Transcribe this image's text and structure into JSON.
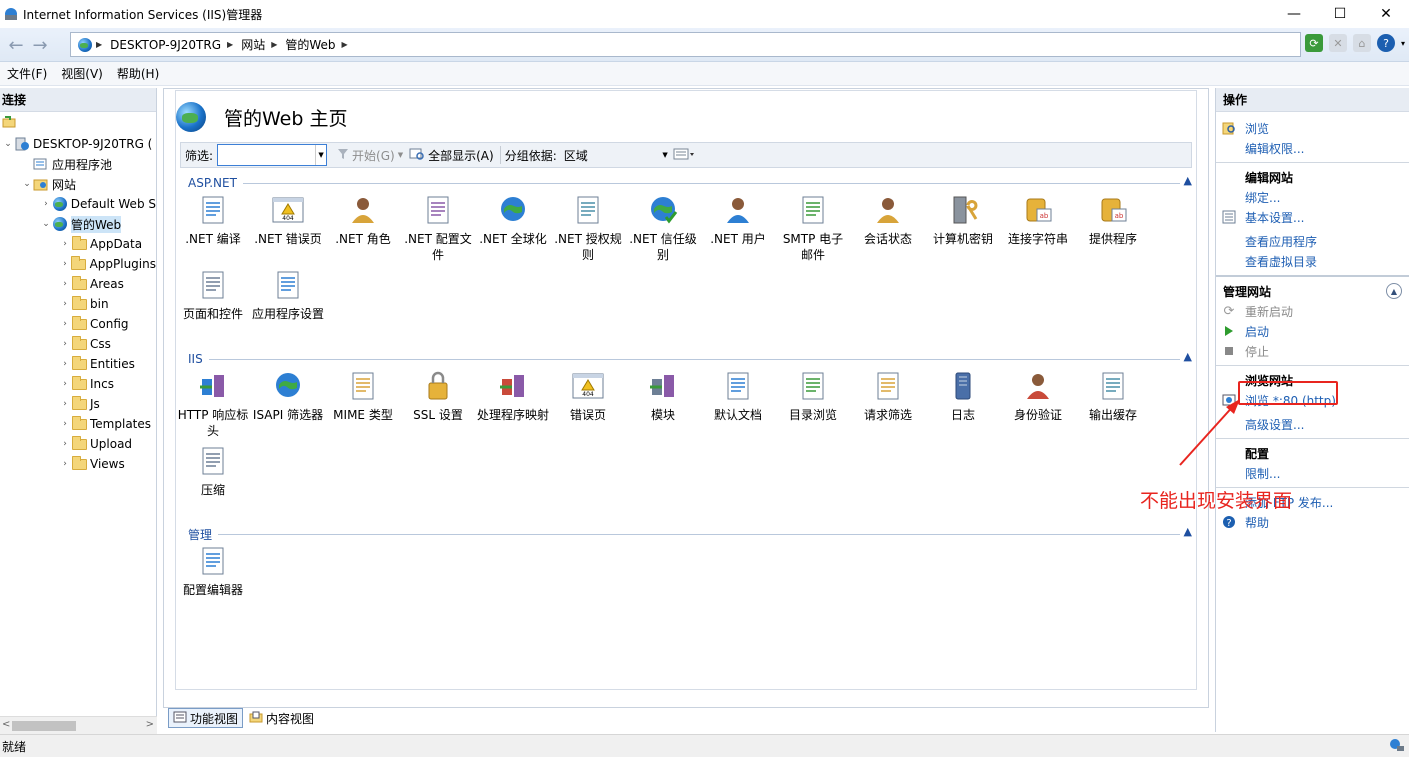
{
  "window": {
    "title": "Internet Information Services (IIS)管理器",
    "minimize": "—",
    "maximize": "☐",
    "close": "✕"
  },
  "address": {
    "crumbs": [
      "DESKTOP-9J20TRG",
      "网站",
      "管的Web"
    ]
  },
  "menu": [
    "文件(F)",
    "视图(V)",
    "帮助(H)"
  ],
  "connections": {
    "title": "连接",
    "tree": [
      {
        "label": "DESKTOP-9J20TRG (",
        "level": 0,
        "twisty": "⌄",
        "icon": "server-icon"
      },
      {
        "label": "应用程序池",
        "level": 1,
        "twisty": "",
        "icon": "app-pool-icon"
      },
      {
        "label": "网站",
        "level": 1,
        "twisty": "⌄",
        "icon": "sites-folder-icon"
      },
      {
        "label": "Default Web S",
        "level": 2,
        "twisty": "›",
        "icon": "globe-icon"
      },
      {
        "label": "管的Web",
        "level": 2,
        "twisty": "⌄",
        "icon": "globe-icon",
        "selected": true
      },
      {
        "label": "AppData",
        "level": 3,
        "twisty": "›",
        "icon": "folder-icon"
      },
      {
        "label": "AppPlugins",
        "level": 3,
        "twisty": "›",
        "icon": "folder-icon"
      },
      {
        "label": "Areas",
        "level": 3,
        "twisty": "›",
        "icon": "folder-icon"
      },
      {
        "label": "bin",
        "level": 3,
        "twisty": "›",
        "icon": "folder-icon"
      },
      {
        "label": "Config",
        "level": 3,
        "twisty": "›",
        "icon": "folder-icon"
      },
      {
        "label": "Css",
        "level": 3,
        "twisty": "›",
        "icon": "folder-icon"
      },
      {
        "label": "Entities",
        "level": 3,
        "twisty": "›",
        "icon": "folder-icon"
      },
      {
        "label": "Incs",
        "level": 3,
        "twisty": "›",
        "icon": "folder-icon"
      },
      {
        "label": "Js",
        "level": 3,
        "twisty": "›",
        "icon": "folder-icon"
      },
      {
        "label": "Templates",
        "level": 3,
        "twisty": "›",
        "icon": "folder-icon"
      },
      {
        "label": "Upload",
        "level": 3,
        "twisty": "›",
        "icon": "folder-icon"
      },
      {
        "label": "Views",
        "level": 3,
        "twisty": "›",
        "icon": "folder-icon"
      }
    ]
  },
  "main": {
    "title": "管的Web 主页",
    "filter": {
      "label": "筛选:",
      "value": "",
      "start": "开始(G)",
      "show_all": "全部显示(A)",
      "group_by": "分组依据:",
      "group_value": "区域"
    },
    "sections": [
      {
        "name": "ASP.NET",
        "items": [
          [
            ".NET 编译",
            "net-compile-icon"
          ],
          [
            ".NET 错误页",
            "net-error-pages-icon"
          ],
          [
            ".NET 角色",
            "net-roles-icon"
          ],
          [
            ".NET 配置文件",
            "net-profile-icon"
          ],
          [
            ".NET 全球化",
            "net-globalization-icon"
          ],
          [
            ".NET 授权规则",
            "net-authorization-icon"
          ],
          [
            ".NET 信任级别",
            "net-trust-icon"
          ],
          [
            ".NET 用户",
            "net-users-icon"
          ],
          [
            "SMTP 电子邮件",
            "smtp-email-icon"
          ],
          [
            "会话状态",
            "session-state-icon"
          ],
          [
            "计算机密钥",
            "machine-key-icon"
          ],
          [
            "连接字符串",
            "connection-strings-icon"
          ],
          [
            "提供程序",
            "providers-icon"
          ],
          [
            "页面和控件",
            "pages-controls-icon"
          ],
          [
            "应用程序设置",
            "app-settings-icon"
          ]
        ]
      },
      {
        "name": "IIS",
        "items": [
          [
            "HTTP 响应标头",
            "http-headers-icon"
          ],
          [
            "ISAPI 筛选器",
            "isapi-filters-icon"
          ],
          [
            "MIME 类型",
            "mime-types-icon"
          ],
          [
            "SSL 设置",
            "ssl-lock-icon"
          ],
          [
            "处理程序映射",
            "handler-mappings-icon"
          ],
          [
            "错误页",
            "error-pages-icon"
          ],
          [
            "模块",
            "modules-icon"
          ],
          [
            "默认文档",
            "default-document-icon"
          ],
          [
            "目录浏览",
            "directory-browsing-icon"
          ],
          [
            "请求筛选",
            "request-filtering-icon"
          ],
          [
            "日志",
            "logging-icon"
          ],
          [
            "身份验证",
            "authentication-icon"
          ],
          [
            "输出缓存",
            "output-cache-icon"
          ],
          [
            "压缩",
            "compression-icon"
          ]
        ]
      },
      {
        "name": "管理",
        "items": [
          [
            "配置编辑器",
            "config-editor-icon"
          ]
        ]
      }
    ],
    "tabs": [
      "功能视图",
      "内容视图"
    ]
  },
  "actions": {
    "title": "操作",
    "group1": [
      [
        "浏览",
        "explore-icon",
        false
      ],
      [
        "编辑权限...",
        "",
        false
      ]
    ],
    "edit_site_title": "编辑网站",
    "group2": [
      [
        "绑定...",
        "",
        false
      ],
      [
        "基本设置...",
        "basic-settings-icon",
        false
      ],
      [
        "查看应用程序",
        "",
        false
      ],
      [
        "查看虚拟目录",
        "",
        false
      ]
    ],
    "manage_title": "管理网站",
    "group3": [
      [
        "重新启动",
        "restart-icon",
        true
      ],
      [
        "启动",
        "start-icon",
        false
      ],
      [
        "停止",
        "stop-icon",
        true
      ]
    ],
    "browse_title": "浏览网站",
    "browse_link": "浏览 *:80 (http)",
    "advanced": "高级设置...",
    "config_title": "配置",
    "limit": "限制...",
    "ftp": "添加 FTP 发布...",
    "help": "帮助"
  },
  "annotation": {
    "text": "不能出现安装界面",
    "color": "#e8251f"
  },
  "status": {
    "text": "就绪"
  }
}
